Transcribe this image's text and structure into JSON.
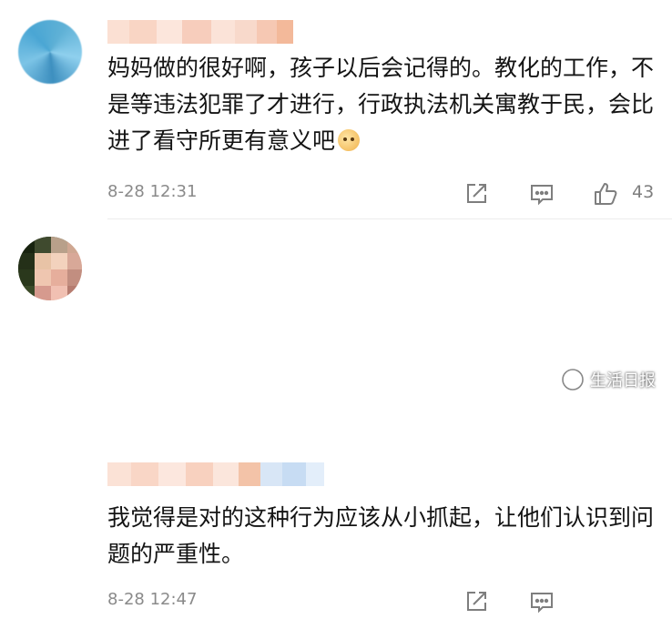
{
  "comments": [
    {
      "text": "妈妈做的很好啊，孩子以后会记得的。教化的工作，不是等违法犯罪了才进行，行政执法机关寓教于民，会比进了看守所更有意义吧",
      "emoji_icon": "dog-face-emoji",
      "time": "8-28 12:31",
      "like_count": "43"
    },
    {
      "text": "我觉得是对的这种行为应该从小抓起，让他们认识到问题的严重性。",
      "time": "8-28 12:47"
    }
  ],
  "watermark": {
    "text": "生活日报",
    "icon": "wechat-official-account-icon"
  },
  "colors": {
    "text": "#141414",
    "meta": "#8a8a8a",
    "icons": "#7e7e7e",
    "divider": "#ededed"
  }
}
